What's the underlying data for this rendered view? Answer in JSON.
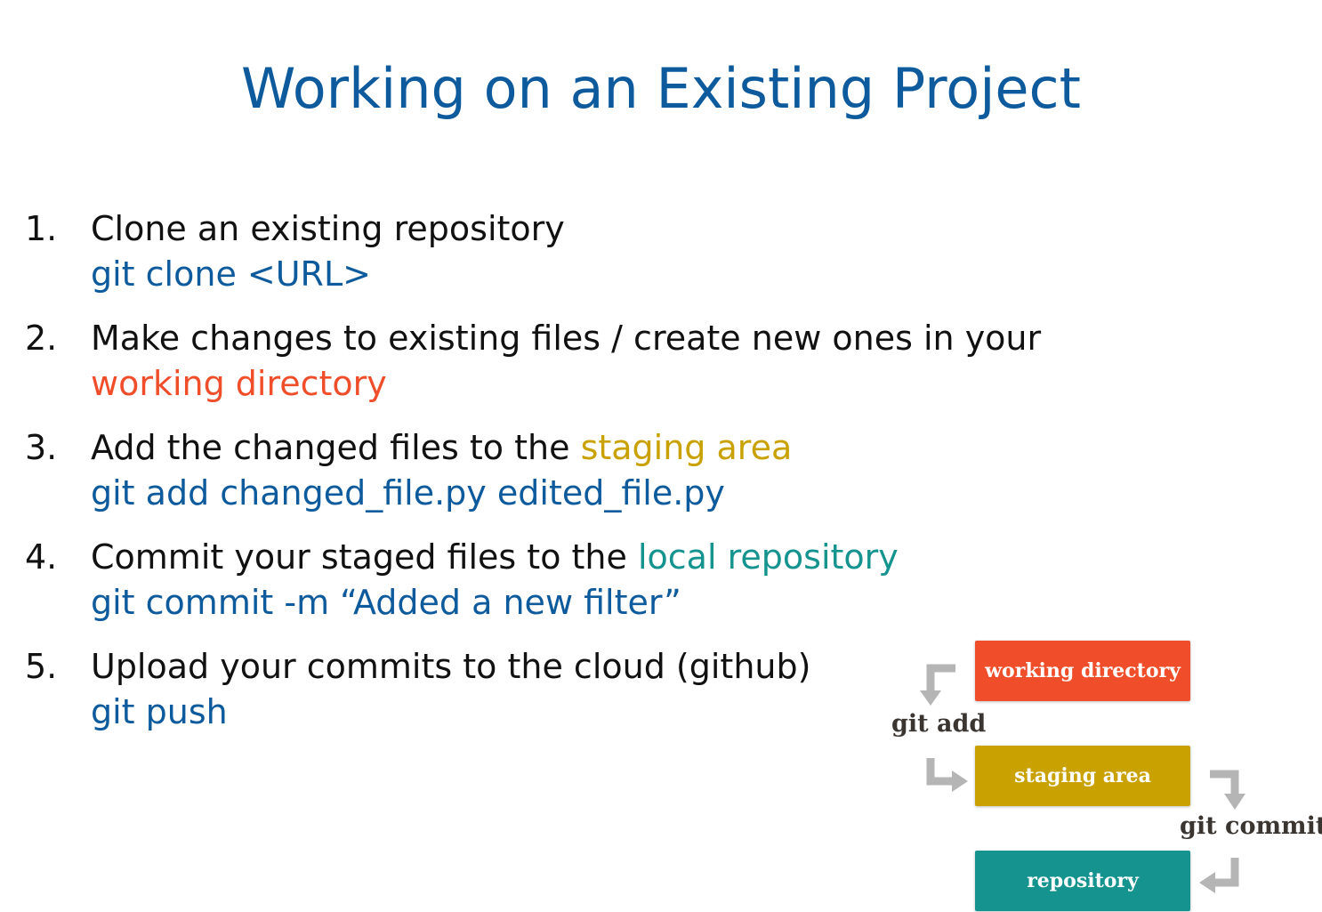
{
  "slide": {
    "title": "Working on an Existing Project"
  },
  "steps": [
    {
      "number": "1.",
      "text": "Clone an existing repository",
      "highlight": "",
      "command": "git clone <URL>"
    },
    {
      "number": "2.",
      "text": "Make changes to existing files / create new ones in your",
      "highlight": "",
      "command": ""
    },
    {
      "number": "3.",
      "text": "Add the changed files to the ",
      "highlight": "staging area",
      "command": "git add changed_file.py edited_file.py"
    },
    {
      "number": "4.",
      "text": "Commit your staged files to the ",
      "highlight": "local repository",
      "command": "git commit -m “Added a new filter”"
    },
    {
      "number": "5.",
      "text": "Upload your commits to the cloud (github)",
      "highlight": "",
      "command": "git push"
    }
  ],
  "step2_second_line": "working directory",
  "diagram": {
    "boxes": {
      "working": "working directory",
      "staging": "staging area",
      "repository": "repository"
    },
    "labels": {
      "add": "git add",
      "commit": "git commit"
    }
  },
  "colors": {
    "title": "#0d5a9c",
    "command": "#0d5a9c",
    "working_directory": "#f04e2a",
    "staging_area": "#c9a100",
    "repository": "#14938f",
    "arrow": "#b5b5b5"
  }
}
